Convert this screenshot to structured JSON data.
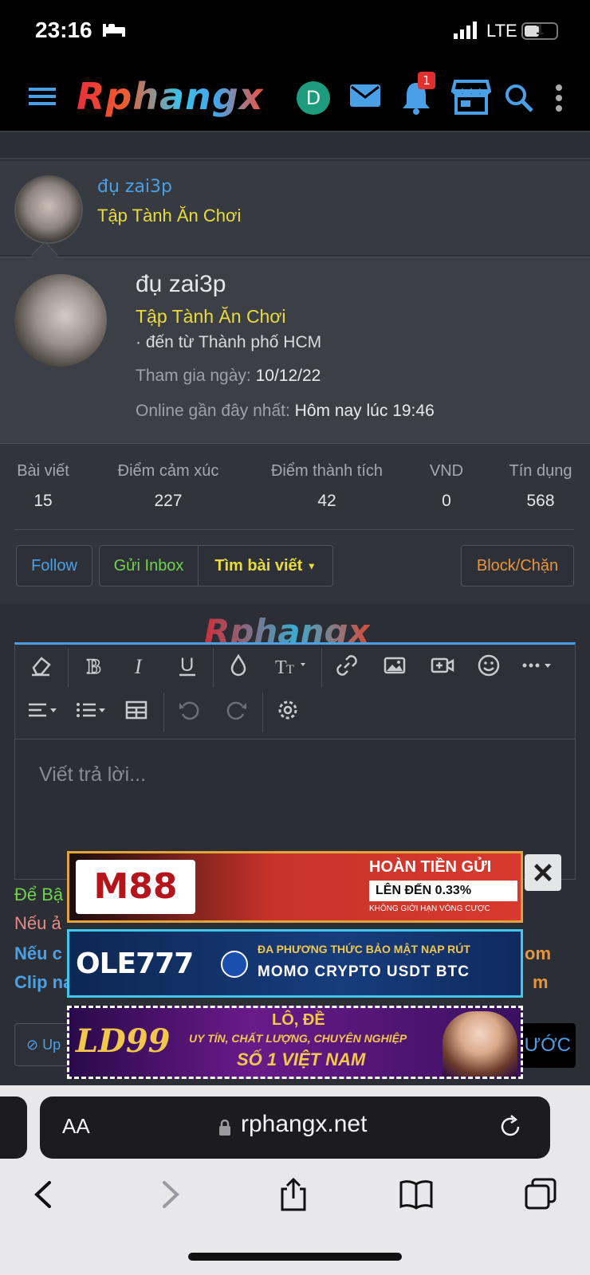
{
  "status_bar": {
    "time": "23:16",
    "network": "LTE",
    "battery": "1"
  },
  "nav": {
    "logo": "Rphangx",
    "avatar_letter": "D",
    "notification_count": "1"
  },
  "profile_header": {
    "name": "đụ zai3p",
    "title": "Tập Tành Ăn Chơi"
  },
  "profile_popup": {
    "name": "đụ zai3p",
    "title": "Tập Tành Ăn Chơi",
    "from": "· đến từ Thành phố HCM",
    "join_label": "Tham gia ngày:",
    "join_value": "10/12/22",
    "online_label": "Online gần đây nhất:",
    "online_value": "Hôm nay lúc 19:46",
    "stats": [
      {
        "label": "Bài viết",
        "value": "15"
      },
      {
        "label": "Điểm cảm xúc",
        "value": "227"
      },
      {
        "label": "Điểm thành tích",
        "value": "42"
      },
      {
        "label": "VND",
        "value": "0"
      },
      {
        "label": "Tín dụng",
        "value": "568"
      }
    ],
    "buttons": {
      "follow": "Follow",
      "inbox": "Gửi Inbox",
      "find_posts": "Tìm bài viết",
      "block": "Block/Chặn"
    }
  },
  "watermark": "Rphangx",
  "editor": {
    "placeholder": "Viết trả lời..."
  },
  "info_lines": [
    {
      "text": "Để Bậ",
      "color": "#6fd44a"
    },
    {
      "text": "Nếu ả",
      "color": "#e98a8a"
    },
    {
      "text": "Nếu c",
      "color": "#4aa0e6"
    },
    {
      "text": "Clip na",
      "color": "#4aa0e6"
    }
  ],
  "info_right": [
    {
      "text": "om",
      "color": "#e8953a"
    },
    {
      "text": "m",
      "color": "#e8953a"
    }
  ],
  "ads": {
    "ad1": {
      "brand": "M88",
      "headline": "HOÀN TIỀN GỬI",
      "sub": "LÊN ĐẾN 0.33%",
      "note": "KHÔNG GIỚI HẠN VÒNG CƯỢC"
    },
    "ad2": {
      "brand": "OLE777",
      "headline": "ĐA PHƯƠNG THỨC BẢO MẬT NẠP RÚT",
      "sub": "MOMO  CRYPTO  USDT  BTC"
    },
    "ad3": {
      "brand": "LD99",
      "headline": "LÔ, ĐỀ",
      "sub": "UY TÍN, CHẤT LƯỢNG, CHUYÊN NGHIỆP",
      "note": "SỐ 1 VIỆT NAM"
    }
  },
  "actions": {
    "upload": "Up",
    "preview": "ƯỚC"
  },
  "browser": {
    "aa": "AA",
    "url": "rphangx.net"
  },
  "colors": {
    "accent": "#4aa0e6",
    "title_yellow": "#e9dc3a",
    "green": "#6fd44a",
    "orange": "#e8953a"
  }
}
